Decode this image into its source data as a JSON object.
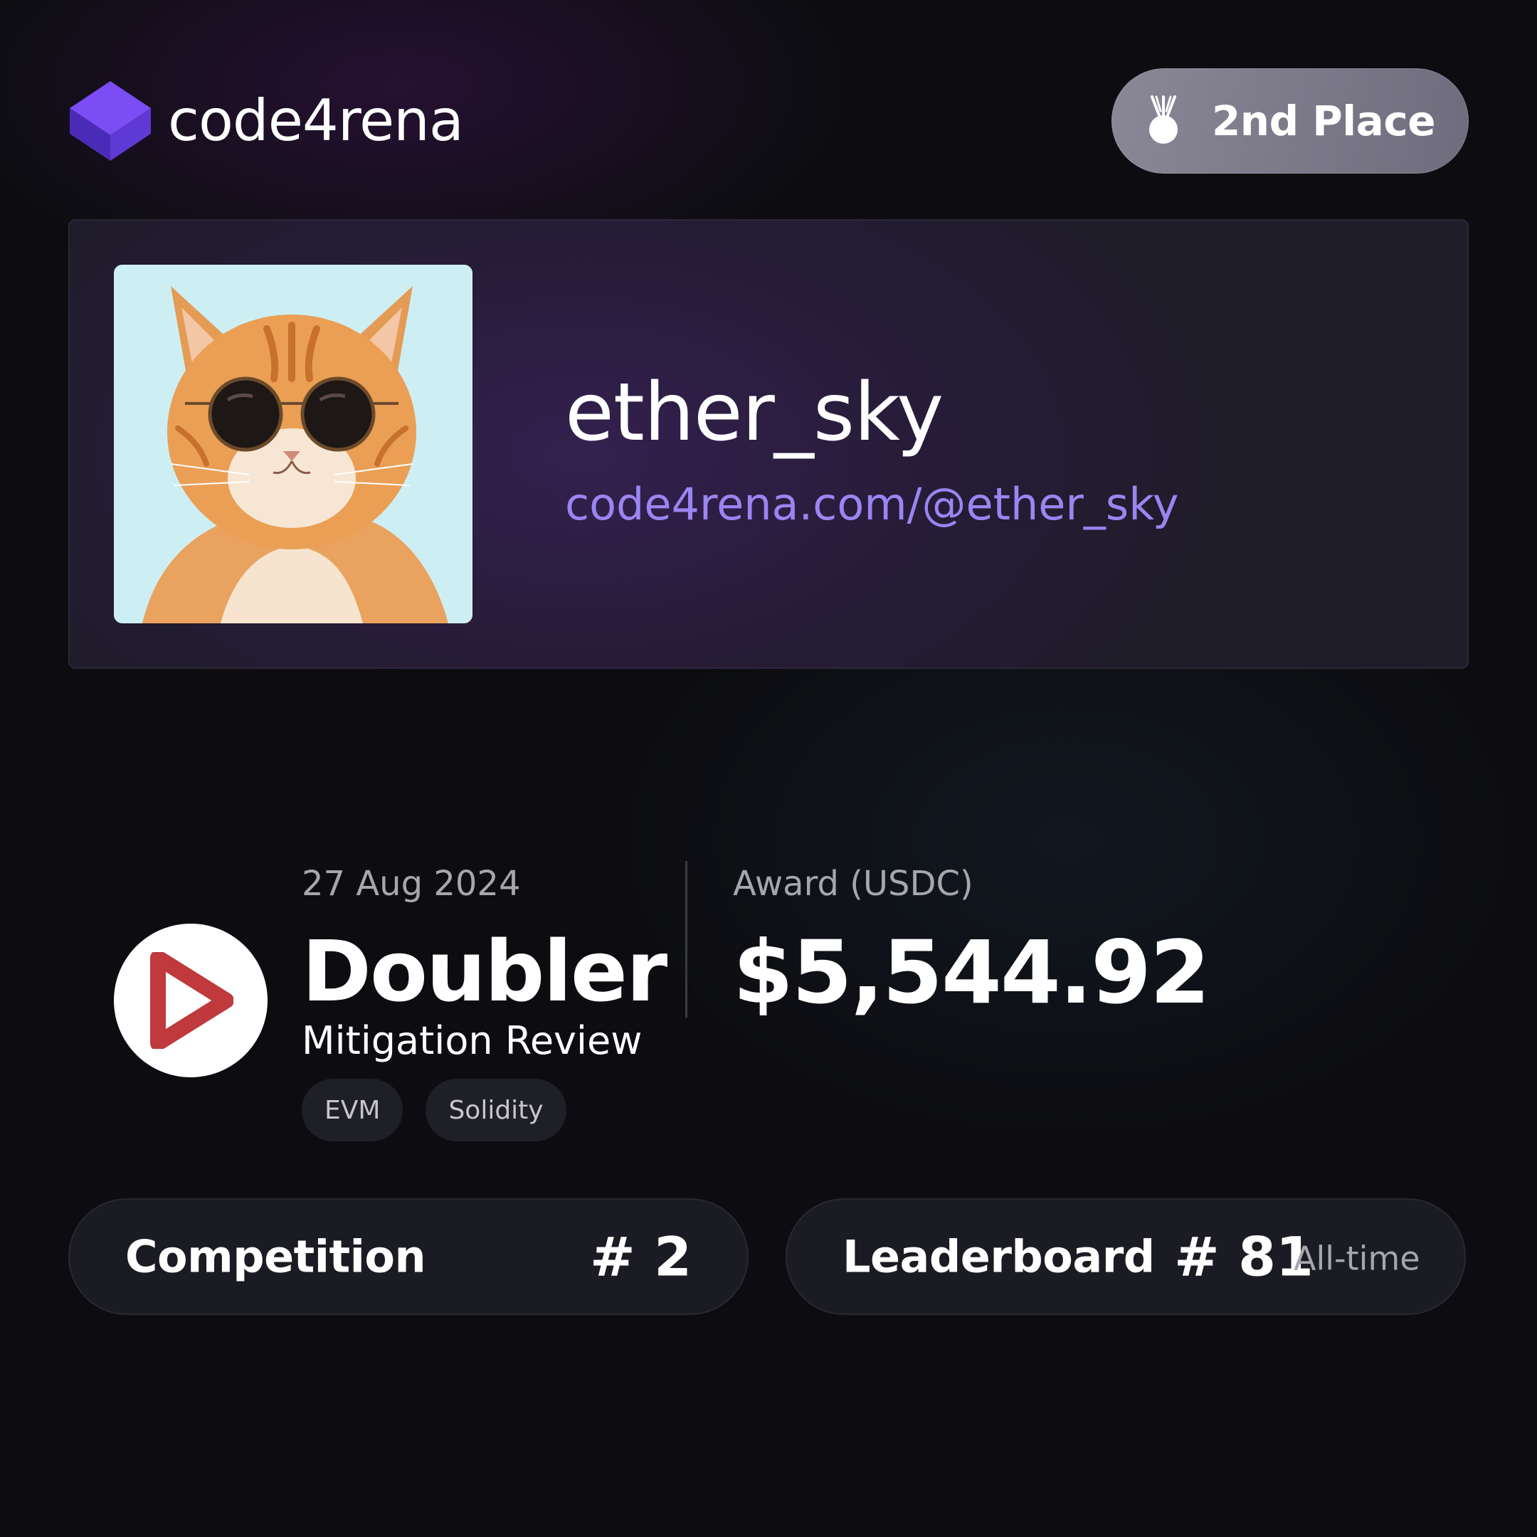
{
  "brand": {
    "name": "code4rena",
    "logo_icon": "cube-logo-icon",
    "accent": "#5b3bd6"
  },
  "badge": {
    "icon": "medal-icon",
    "label": "2nd Place"
  },
  "profile": {
    "username": "ether_sky",
    "link": "code4rena.com/@ether_sky",
    "link_color": "#9a85f2",
    "avatar": "cat-with-sunglasses-avatar"
  },
  "contest": {
    "date": "27 Aug 2024",
    "name": "Doubler",
    "type": "Mitigation Review",
    "logo_icon": "play-triangle-icon",
    "logo_color": "#c0393d",
    "tags": [
      "EVM",
      "Solidity"
    ]
  },
  "award": {
    "label": "Award (USDC)",
    "value": "$5,544.92"
  },
  "stats": {
    "competition": {
      "label": "Competition",
      "rank": "# 2"
    },
    "leaderboard": {
      "label": "Leaderboard",
      "rank": "# 81",
      "period": "All-time"
    }
  }
}
